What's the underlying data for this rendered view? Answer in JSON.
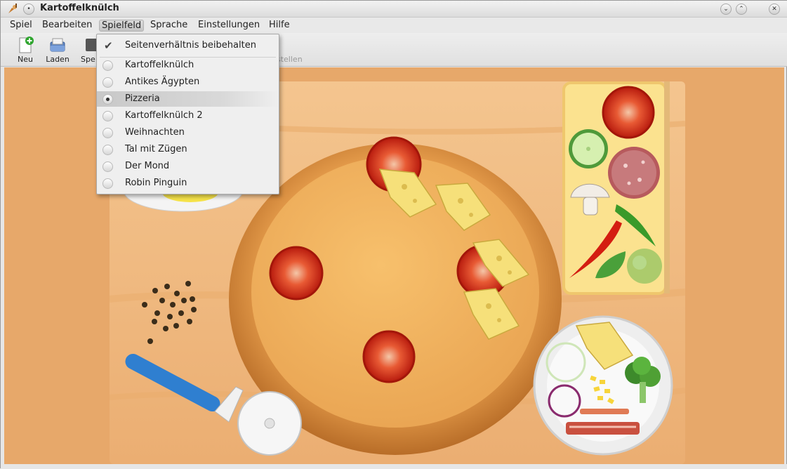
{
  "window": {
    "title": "Kartoffelknülch"
  },
  "menubar": {
    "items": [
      {
        "label": "Spiel"
      },
      {
        "label": "Bearbeiten"
      },
      {
        "label": "Spielfeld"
      },
      {
        "label": "Sprache"
      },
      {
        "label": "Einstellungen"
      },
      {
        "label": "Hilfe"
      }
    ]
  },
  "toolbar": {
    "new_label": "Neu",
    "load_label": "Laden",
    "save_label_partial": "Spe",
    "hidden_label_partial": "stellen"
  },
  "spielfeld_menu": {
    "keep_aspect": {
      "label": "Seitenverhältnis beibehalten",
      "checked": true
    },
    "themes": [
      {
        "label": "Kartoffelknülch",
        "selected": false
      },
      {
        "label": "Antikes Ägypten",
        "selected": false
      },
      {
        "label": "Pizzeria",
        "selected": true
      },
      {
        "label": "Kartoffelknülch 2",
        "selected": false
      },
      {
        "label": "Weihnachten",
        "selected": false
      },
      {
        "label": "Tal mit Zügen",
        "selected": false
      },
      {
        "label": "Der Mond",
        "selected": false
      },
      {
        "label": "Robin Pinguin",
        "selected": false
      }
    ]
  },
  "colors": {
    "table": "#e7a86a",
    "crust": "#d7923f",
    "sauce": "#f2b65f",
    "tomato": "#d92d18",
    "cheese": "#f6e07a",
    "roller_handle": "#2f7fd0"
  }
}
